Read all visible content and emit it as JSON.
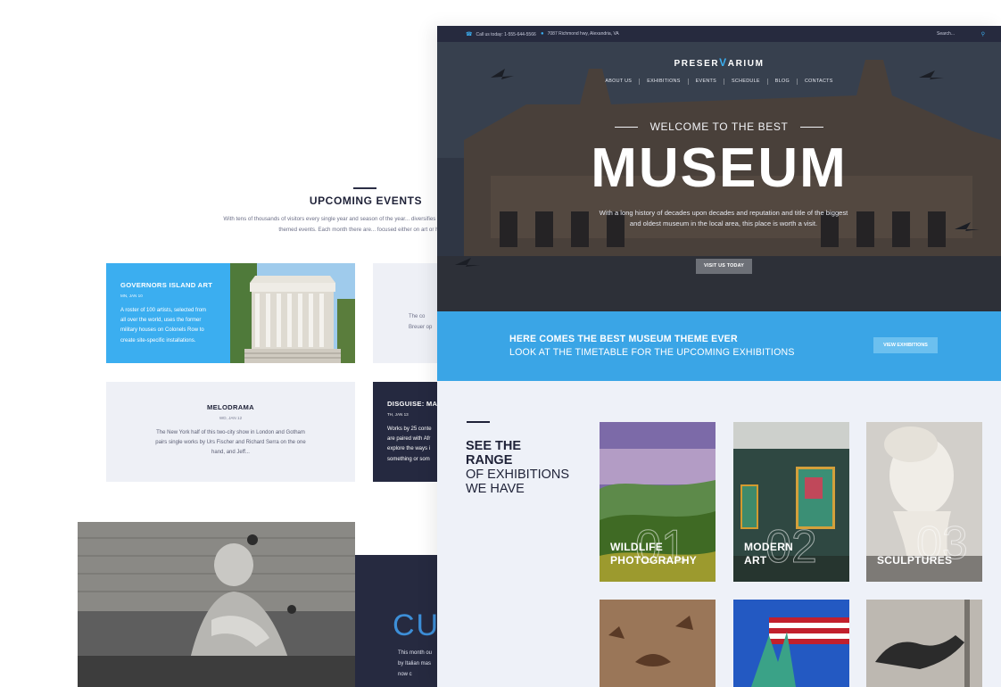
{
  "back_page": {
    "upcoming": {
      "title": "UPCOMING EVENTS",
      "text": "With tens of thousands of visitors every single year and season of the year... diversifies its schedule by hosting many themed events. Each month there are... focused either on art or history."
    },
    "events": [
      {
        "title": "GOVERNORS ISLAND ART",
        "date": "MN, JAN 10",
        "text_lines": [
          "A roster of 100 artists, selected from",
          "all over the world, uses the former",
          "military houses on Colonels Row to",
          "create site-specific installations."
        ]
      },
      {
        "peek_lines": [
          "The co",
          "Breuer op"
        ]
      },
      {
        "title": "MELODRAMA",
        "date": "WD, JAN 12",
        "text_lines": [
          "The New York half of this two-city show in London and Gotham",
          "pairs single works by Urs Fischer and Richard Serra on the one",
          "hand, and Jeff..."
        ]
      },
      {
        "title": "DISGUISE: MAS",
        "date": "TH, JAN 13",
        "text_lines": [
          "Works by 25 conte",
          "are paired with Afr",
          "explore the ways i",
          "something or som"
        ]
      }
    ],
    "cu": {
      "big": "CU",
      "text_lines": [
        "This month ou",
        "by Italian mas",
        "now c"
      ]
    }
  },
  "topbar": {
    "phone": "Call us today: 1-555-644-5566",
    "address": "7087 Richmond hwy, Alexandria, VA",
    "search_placeholder": "Search...",
    "phone_icon": "phone-icon",
    "pin_icon": "pin-icon",
    "search_icon": "search-icon"
  },
  "logo": {
    "pre": "PRESER",
    "v": "V",
    "post": "ARIUM"
  },
  "nav": [
    "ABOUT US",
    "EXHIBITIONS",
    "EVENTS",
    "SCHEDULE",
    "BLOG",
    "CONTACTS"
  ],
  "hero": {
    "welcome": "WELCOME TO THE BEST",
    "title": "MUSEUM",
    "text": "With a long history of decades upon decades and reputation and title of the biggest and oldest museum in the local area, this place is worth a visit.",
    "button": "VISIT US TODAY"
  },
  "banner": {
    "line1": "HERE COMES THE BEST MUSEUM THEME EVER",
    "line2": "LOOK AT THE TIMETABLE FOR THE UPCOMING EXHIBITIONS",
    "button": "VIEW EXHIBITIONS"
  },
  "range": {
    "bold1": "SEE THE",
    "bold2": "RANGE",
    "light1": "OF EXHIBITIONS",
    "light2": "WE HAVE"
  },
  "exhibitions": [
    {
      "line1": "WILDLIFE",
      "line2": "PHOTOGRAPHY",
      "num": "01"
    },
    {
      "line1": "MODERN",
      "line2": "ART",
      "num": "02"
    },
    {
      "line1": "",
      "line2": "SCULPTURES",
      "num": "03"
    }
  ],
  "colors": {
    "accent": "#3baef0",
    "banner": "#3aa5e6",
    "dark": "#262a3e"
  }
}
